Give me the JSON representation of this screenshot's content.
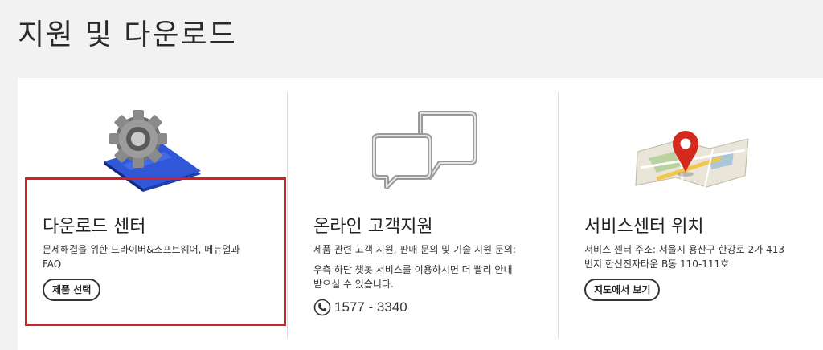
{
  "page": {
    "title": "지원 및 다운로드"
  },
  "cards": [
    {
      "title": "다운로드 센터",
      "lines": [
        "문제해결을 위한 드라이버&소프트웨어, 메뉴얼과",
        "FAQ"
      ],
      "button": "제품 선택",
      "icon": "manual-gear-icon"
    },
    {
      "title": "온라인 고객지원",
      "lines": [
        "제품 관련 고객 지원, 판매 문의 및 기술 지원 문의:",
        "우측 하단 챗봇 서비스를 이용하시면 더 빨리 안내",
        "받으실 수 있습니다."
      ],
      "phone": "1577 - 3340",
      "icon": "chat-bubbles-icon"
    },
    {
      "title": "서비스센터 위치",
      "lines": [
        "서비스 센터 주소: 서울시 용산구 한강로 2가 413",
        "번지 한신전자타운 B동 110-111호"
      ],
      "button": "지도에서 보기",
      "icon": "map-pin-icon"
    }
  ],
  "colors": {
    "highlight": "#d42025",
    "background": "#f2f2f2"
  }
}
